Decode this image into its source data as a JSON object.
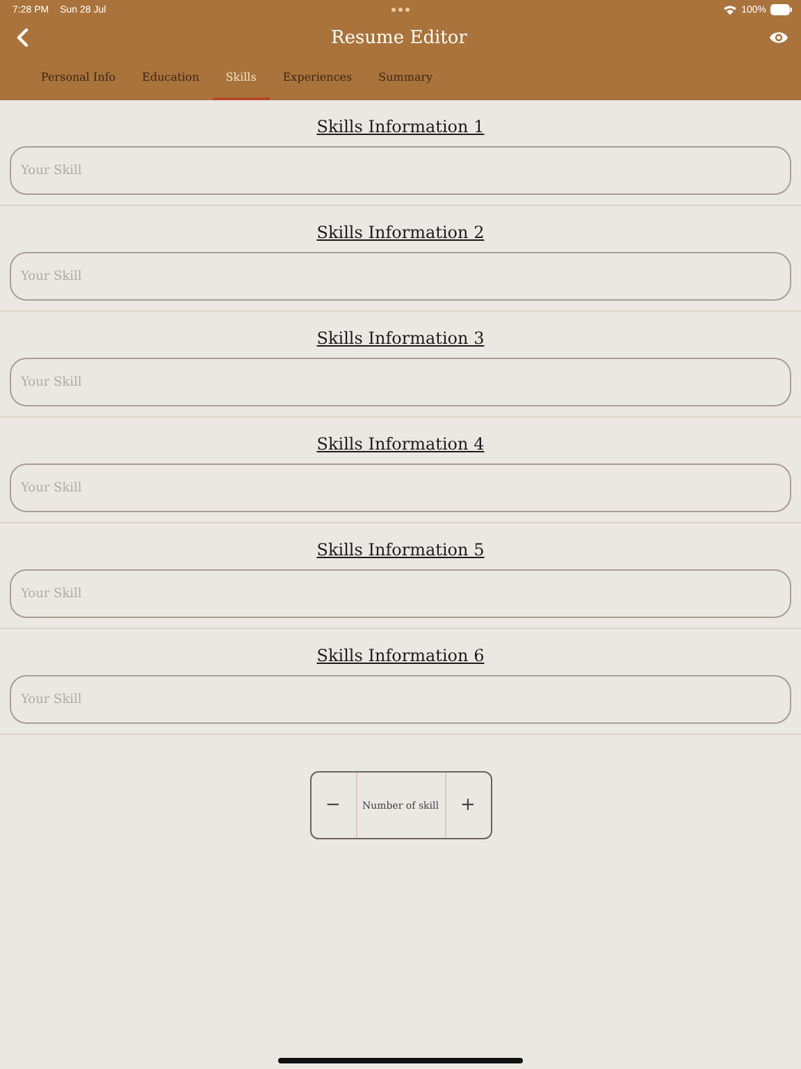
{
  "status_bar": {
    "time": "7:28 PM",
    "date": "Sun 28 Jul",
    "battery": "100%"
  },
  "nav": {
    "title": "Resume Editor"
  },
  "tabs": [
    {
      "label": "Personal Info",
      "selected": false
    },
    {
      "label": "Education",
      "selected": false
    },
    {
      "label": "Skills",
      "selected": true
    },
    {
      "label": "Experiences",
      "selected": false
    },
    {
      "label": "Summary",
      "selected": false
    }
  ],
  "sections": [
    {
      "title": "Skills Information 1",
      "placeholder": "Your Skill"
    },
    {
      "title": "Skills Information 2",
      "placeholder": "Your Skill"
    },
    {
      "title": "Skills Information 3",
      "placeholder": "Your Skill"
    },
    {
      "title": "Skills Information 4",
      "placeholder": "Your Skill"
    },
    {
      "title": "Skills Information 5",
      "placeholder": "Your Skill"
    },
    {
      "title": "Skills Information 6",
      "placeholder": "Your Skill"
    }
  ],
  "stepper": {
    "decrement": "−",
    "label": "Number of skill",
    "increment": "+"
  }
}
